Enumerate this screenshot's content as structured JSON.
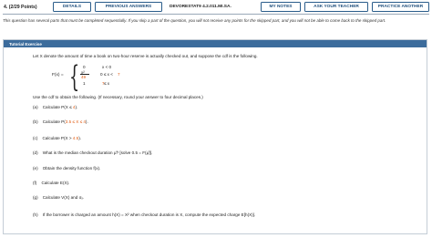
{
  "topbar": {
    "question_number": "4.",
    "points": "(2/29 Points)",
    "details": "DETAILS",
    "previous_answers": "PREVIOUS ANSWERS",
    "reference": "DEVORESTAT9 4.2.011.MI.SA.",
    "my_notes": "MY NOTES",
    "ask_teacher": "ASK YOUR TEACHER",
    "practice_another": "PRACTICE ANOTHER"
  },
  "intro": "This question has several parts that must be completed sequentially. If you skip a part of the question, you will not receive any points for the skipped part, and you will not be able to come back to the skipped part.",
  "exercise": {
    "header": "Tutorial Exercise",
    "statement": "Let X denote the amount of time a book on two-hour reserve is actually checked out, and suppose the cdf is the following.",
    "cdf_label": "F(x) =",
    "case1_val": "0",
    "case1_cond": "x < 0",
    "case2_val_num": "x²",
    "case2_val_den": "49",
    "case2_cond_a": "0 ≤ x <",
    "case2_cond_b": "7",
    "case3_val": "1",
    "case3_cond_a": "7",
    "case3_cond_b": " ≤ x",
    "instruction": "Use the cdf to obtain the following. (If necessary, round your answer to four decimal places.)",
    "parts": [
      {
        "label": "(a)",
        "text": "Calculate P(X ≤ ",
        "orange": "4",
        "tail": ")."
      },
      {
        "label": "(b)",
        "text": "Calculate P(",
        "orange": "3.5 ≤ X ≤ 4",
        "tail": ")."
      },
      {
        "label": "(c)",
        "text": "Calculate P(X > ",
        "orange": "4.5",
        "tail": ")."
      },
      {
        "label": "(d)",
        "text": "What is the median checkout duration μ̃? [solve 0.5 = F(μ̃)].",
        "orange": "",
        "tail": ""
      },
      {
        "label": "(e)",
        "text": "Obtain the density function f(x).",
        "orange": "",
        "tail": ""
      },
      {
        "label": "(f)",
        "text": "Calculate E(X).",
        "orange": "",
        "tail": ""
      },
      {
        "label": "(g)",
        "text": "Calculate V(X) and σₓ.",
        "orange": "",
        "tail": ""
      },
      {
        "label": "(h)",
        "text": "If the borrower is charged an amount h(X) = X² when checkout duration is X, compute the expected charge E[h(X)].",
        "orange": "",
        "tail": ""
      }
    ]
  },
  "colors": {
    "header_bg": "#3c6c9c",
    "button_text": "#1f4f7d",
    "highlight": "#e05a10"
  }
}
